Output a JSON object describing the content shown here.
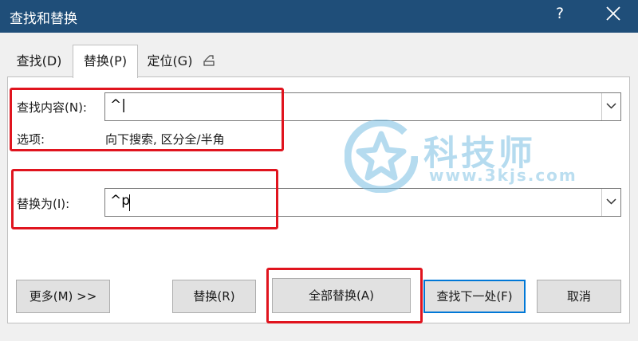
{
  "window": {
    "title": "查找和替换",
    "help_label": "?"
  },
  "tabs": [
    {
      "label": "查找(D)",
      "active": false
    },
    {
      "label": "替换(P)",
      "active": true
    },
    {
      "label": "定位(G)",
      "active": false
    }
  ],
  "find": {
    "label": "查找内容(N):",
    "value": "^|"
  },
  "options": {
    "label": "选项:",
    "value": "向下搜索, 区分全/半角"
  },
  "replace": {
    "label": "替换为(I):",
    "value": "^p"
  },
  "buttons": {
    "more": "更多(M) >>",
    "replace": "替换(R)",
    "replace_all": "全部替换(A)",
    "find_next": "查找下一处(F)",
    "cancel": "取消"
  },
  "watermark": {
    "brand": "科技师",
    "url": "www.3kjs.com"
  },
  "colors": {
    "titlebar": "#1f4e79",
    "highlight": "#e0141e",
    "focus": "#0078d7",
    "watermark": "#78bee1"
  }
}
